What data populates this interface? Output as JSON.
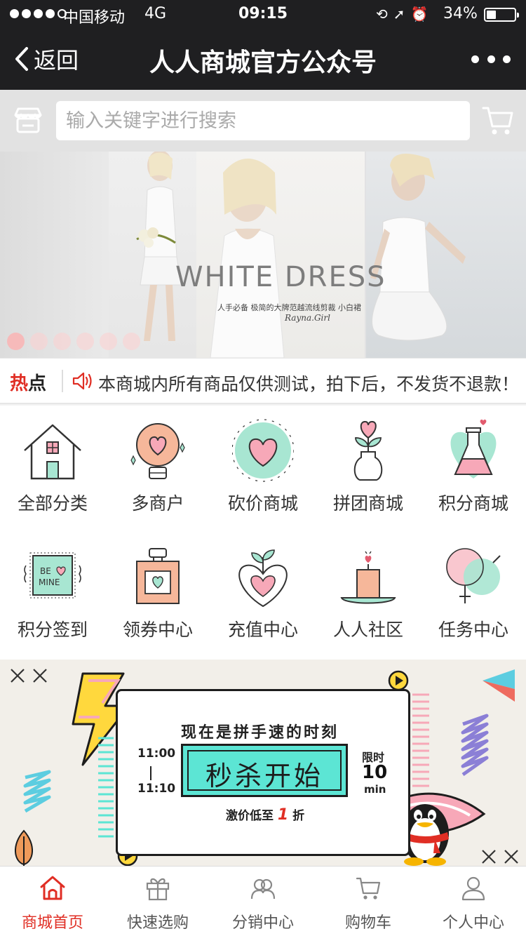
{
  "status_bar": {
    "carrier": "中国移动",
    "network": "4G",
    "time": "09:15",
    "battery": "34%",
    "battery_level": 0.34,
    "icons": [
      "lock-rotation-icon",
      "location-arrow-icon",
      "alarm-icon"
    ]
  },
  "nav": {
    "back_label": "返回",
    "title": "人人商城官方公众号"
  },
  "search": {
    "placeholder": "输入关键字进行搜索"
  },
  "banner": {
    "headline": "WHITE DRESS",
    "subtitle": "人手必备 极简的大牌范越流线剪裁 小白裙",
    "brand": "Rayna.Girl",
    "slide_count": 6,
    "active_slide": 0
  },
  "notice": {
    "tag_a": "热",
    "tag_b": "点",
    "text": "本商城内所有商品仅供测试，拍下后，不发货不退款！"
  },
  "categories": [
    {
      "label": "全部分类",
      "icon": "house-icon"
    },
    {
      "label": "多商户",
      "icon": "lightbulb-heart-icon"
    },
    {
      "label": "砍价商城",
      "icon": "heart-circle-icon"
    },
    {
      "label": "拼团商城",
      "icon": "flower-vase-icon"
    },
    {
      "label": "积分商城",
      "icon": "flask-heart-icon"
    },
    {
      "label": "积分签到",
      "icon": "be-mine-card-icon"
    },
    {
      "label": "领券中心",
      "icon": "perfume-bottle-icon"
    },
    {
      "label": "充值中心",
      "icon": "heart-sprout-icon"
    },
    {
      "label": "人人社区",
      "icon": "candle-icon"
    },
    {
      "label": "任务中心",
      "icon": "venus-mars-icon"
    }
  ],
  "promo": {
    "tagline": "现在是拼手速的时刻",
    "time_start": "11:00",
    "time_sep": "|",
    "time_end": "11:10",
    "headline": "秒杀开始",
    "limit_label": "限时",
    "limit_value": "10",
    "limit_unit": "min",
    "discount_prefix": "激价低至",
    "discount_value": "1",
    "discount_suffix": "折",
    "colors": {
      "accent": "#5ce5d4",
      "pink": "#f7a8b8",
      "yellow": "#ffd83d",
      "purple": "#8b7fd6"
    }
  },
  "tabs": [
    {
      "label": "商城首页",
      "icon": "home-icon",
      "active": true
    },
    {
      "label": "快速选购",
      "icon": "gift-icon",
      "active": false
    },
    {
      "label": "分销中心",
      "icon": "people-icon",
      "active": false
    },
    {
      "label": "购物车",
      "icon": "cart-icon",
      "active": false
    },
    {
      "label": "个人中心",
      "icon": "user-icon",
      "active": false
    }
  ],
  "colors": {
    "brand_red": "#e02e24",
    "bar_dark": "#1f1f21",
    "icon_pink": "#f7a8b8",
    "icon_mint": "#a8e6d2"
  }
}
